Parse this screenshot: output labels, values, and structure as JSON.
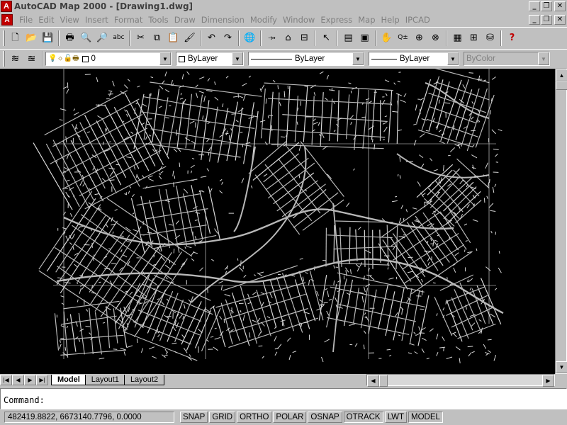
{
  "window": {
    "title": "AutoCAD Map 2000 - [Drawing1.dwg]",
    "min_glyph": "_",
    "max_glyph": "❐",
    "close_glyph": "✕"
  },
  "menu": {
    "items": [
      "File",
      "Edit",
      "View",
      "Insert",
      "Format",
      "Tools",
      "Draw",
      "Dimension",
      "Modify",
      "Window",
      "Express",
      "Map",
      "Help",
      "IPCAD"
    ]
  },
  "toolbar1": {
    "buttons": [
      {
        "name": "new-icon",
        "glyph": "🗋"
      },
      {
        "name": "open-icon",
        "glyph": "📂"
      },
      {
        "name": "save-icon",
        "glyph": "💾"
      },
      {
        "sep": true
      },
      {
        "name": "print-icon",
        "glyph": "🖶"
      },
      {
        "name": "print-preview-icon",
        "glyph": "🔍"
      },
      {
        "name": "find-icon",
        "glyph": "🔎"
      },
      {
        "name": "spelling-icon",
        "glyph": "abc"
      },
      {
        "sep": true
      },
      {
        "name": "cut-icon",
        "glyph": "✂"
      },
      {
        "name": "copy-icon",
        "glyph": "⧉"
      },
      {
        "name": "paste-icon",
        "glyph": "📋"
      },
      {
        "name": "match-properties-icon",
        "glyph": "🖌"
      },
      {
        "sep": true
      },
      {
        "name": "undo-icon",
        "glyph": "↶"
      },
      {
        "name": "redo-icon",
        "glyph": "↷"
      },
      {
        "sep": true
      },
      {
        "name": "hyperlink-icon",
        "glyph": "🌐"
      },
      {
        "sep": true
      },
      {
        "name": "tracking-icon",
        "glyph": "⤞"
      },
      {
        "name": "ucs-icon",
        "glyph": "⌂"
      },
      {
        "name": "measure-icon",
        "glyph": "⊟"
      },
      {
        "sep": true
      },
      {
        "name": "pick-icon",
        "glyph": "↖"
      },
      {
        "sep": true
      },
      {
        "name": "named-views-icon",
        "glyph": "▤"
      },
      {
        "name": "views-icon",
        "glyph": "▣"
      },
      {
        "sep": true
      },
      {
        "name": "pan-icon",
        "glyph": "✋"
      },
      {
        "name": "zoom-realtime-icon",
        "glyph": "Q±"
      },
      {
        "name": "zoom-window-icon",
        "glyph": "⊕"
      },
      {
        "name": "zoom-previous-icon",
        "glyph": "⊗"
      },
      {
        "sep": true
      },
      {
        "name": "properties-icon",
        "glyph": "▦"
      },
      {
        "name": "design-center-icon",
        "glyph": "⊞"
      },
      {
        "name": "dbconnect-icon",
        "glyph": "⛁"
      },
      {
        "sep": true
      },
      {
        "name": "help-icon",
        "glyph": "?"
      }
    ]
  },
  "toolbar2": {
    "layer_buttons": [
      {
        "name": "layers-icon",
        "glyph": "≋"
      },
      {
        "name": "make-object-layer-current-icon",
        "glyph": "≊"
      }
    ],
    "layer_value": "0",
    "layer_state_glyphs": "💡☼🔓🖶",
    "color_value": "ByLayer",
    "linetype_value": "ByLayer",
    "lineweight_value": "ByLayer",
    "plotstyle_value": "ByColor"
  },
  "tabs": {
    "items": [
      "Model",
      "Layout1",
      "Layout2"
    ],
    "active": "Model"
  },
  "command": {
    "prompt": "Command:"
  },
  "status": {
    "coordinates": "482419.8822, 6673140.7796, 0.0000",
    "modes": [
      "SNAP",
      "GRID",
      "ORTHO",
      "POLAR",
      "OSNAP",
      "OTRACK",
      "LWT",
      "MODEL"
    ],
    "pressed": [
      "OTRACK",
      "MODEL"
    ]
  },
  "colors": {
    "background": "#000000",
    "road_major": "#b8b8b8",
    "road_minor": "#d8d8d8",
    "frame": "#e8e8e8"
  }
}
